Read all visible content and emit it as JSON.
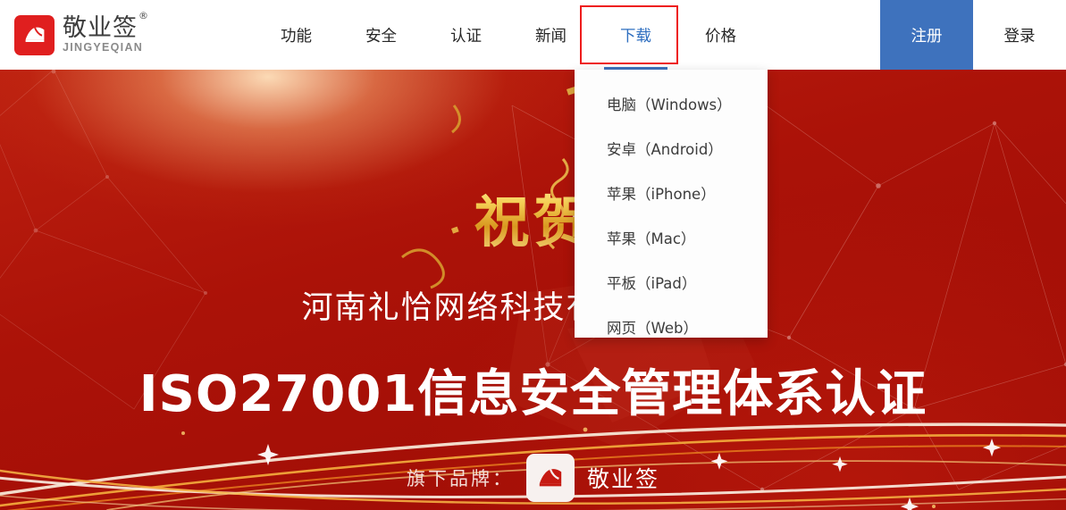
{
  "header": {
    "logo": {
      "icon": "jingyeqian-logo-icon",
      "cn_name": "敬业签",
      "registered_mark": "®",
      "en_name": "JINGYEQIAN",
      "mark_bg": "#e01f1f"
    },
    "nav": [
      {
        "label": "功能",
        "active": false
      },
      {
        "label": "安全",
        "active": false
      },
      {
        "label": "认证",
        "active": false
      },
      {
        "label": "新闻",
        "active": false
      },
      {
        "label": "下载",
        "active": true
      },
      {
        "label": "价格",
        "active": false
      }
    ],
    "register_label": "注册",
    "login_label": "登录",
    "register_bg": "#3e72bd",
    "active_color": "#2f6fc0",
    "annotation_color": "#ee1c1c"
  },
  "dropdown": {
    "parent": "下载",
    "items": [
      {
        "label": "电脑（Windows）"
      },
      {
        "label": "安卓（Android）"
      },
      {
        "label": "苹果（iPhone）"
      },
      {
        "label": "苹果（Mac）"
      },
      {
        "label": "平板（iPad）"
      },
      {
        "label": "网页（Web）"
      }
    ]
  },
  "banner": {
    "congrats_text": "祝贺",
    "subline": "河南礼恰网络科技有限公司通过",
    "headline": "ISO27001信息安全管理体系认证",
    "brand_label": "旗下品牌：",
    "brand_icon": "jingyeqian-logo-icon",
    "brand_name": "敬业签",
    "bg_color_deep": "#a81008",
    "bg_color_bright": "#e08659",
    "gold_color": "#f0c452"
  }
}
